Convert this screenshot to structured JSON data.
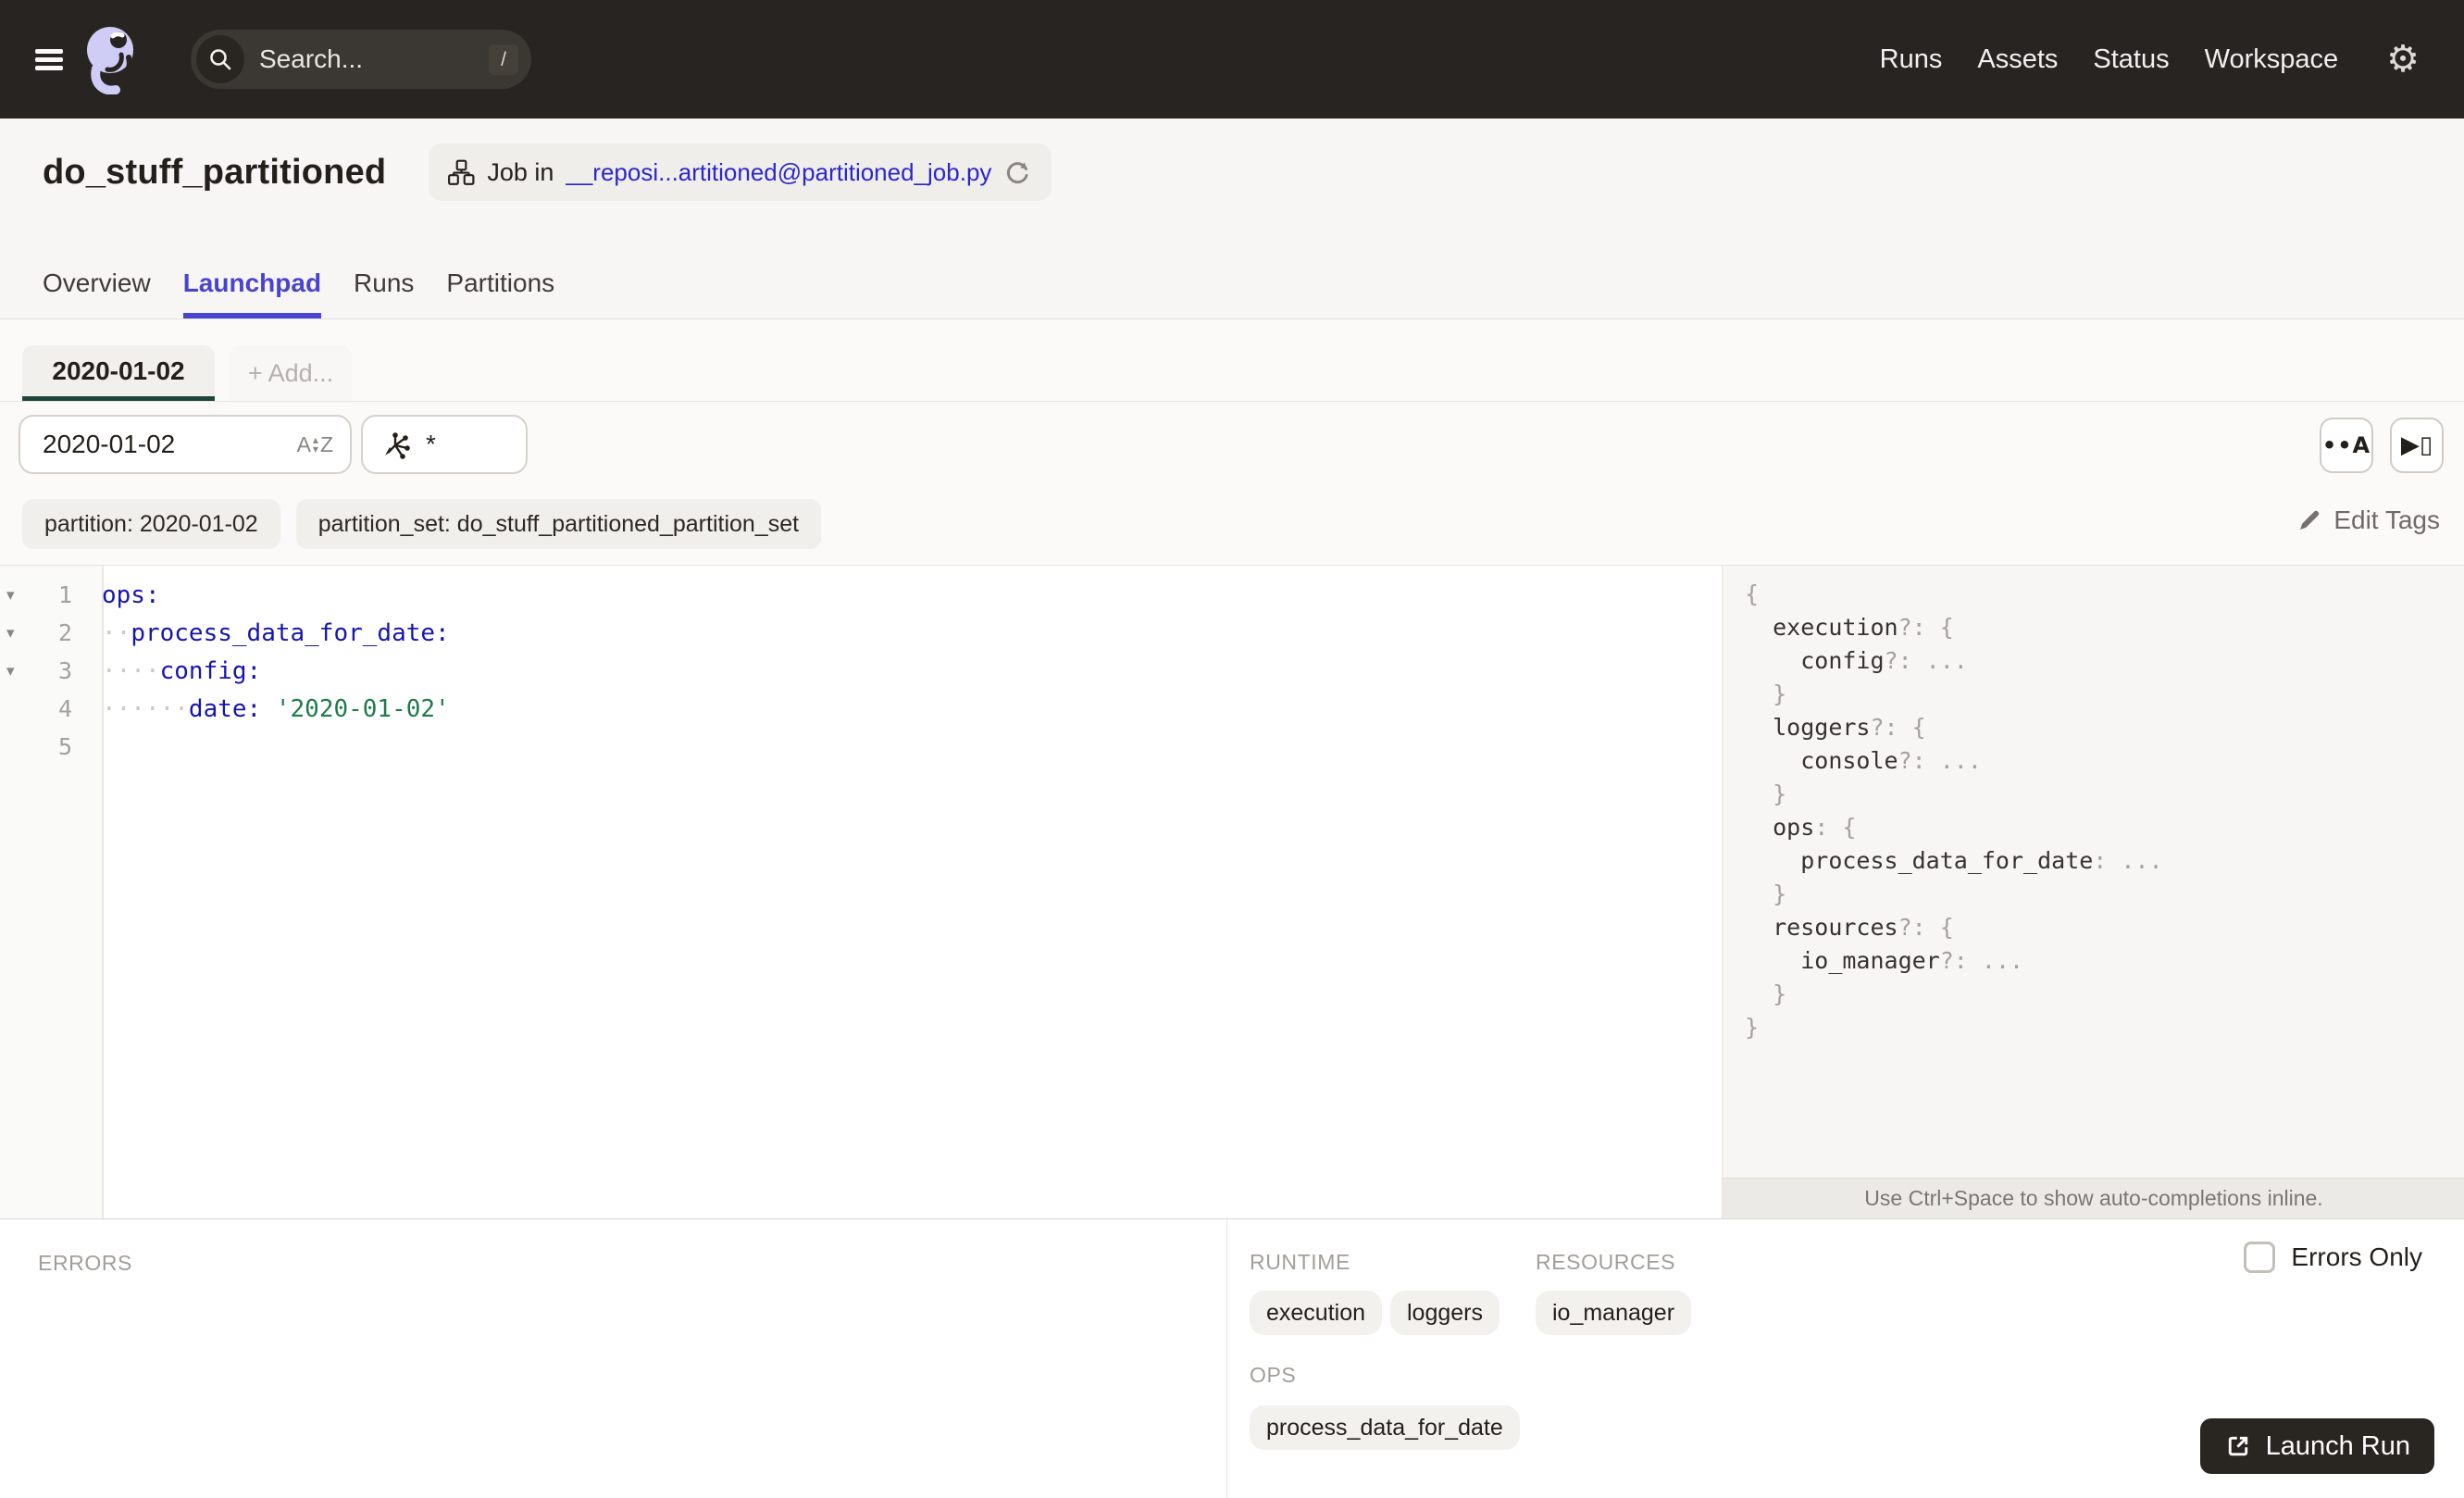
{
  "colors": {
    "topbar_bg": "#282421",
    "accent_blue": "#4a43d2",
    "link_blue": "#2d26c9",
    "partition_underline_green": "#21453a",
    "code_key": "#1715ad",
    "code_string": "#1e7b4a",
    "chip_bg": "#f3f1ee",
    "launch_button_bg": "#292521"
  },
  "topbar": {
    "search_placeholder": "Search...",
    "search_shortcut": "/",
    "nav": [
      "Runs",
      "Assets",
      "Status",
      "Workspace"
    ]
  },
  "header": {
    "title": "do_stuff_partitioned",
    "job_prefix": "Job in",
    "job_link": "__reposi...artitioned@partitioned_job.py"
  },
  "tabs": [
    "Overview",
    "Launchpad",
    "Runs",
    "Partitions"
  ],
  "partition_tabs": {
    "active": "2020-01-02",
    "add": "+ Add..."
  },
  "controls": {
    "partition_value": "2020-01-02",
    "op_query": "*",
    "autocomplete_button": "••A",
    "apply_button": "▶▯"
  },
  "tags": [
    "partition: 2020-01-02",
    "partition_set: do_stuff_partitioned_partition_set"
  ],
  "edit_tags": "Edit Tags",
  "editor": {
    "fold_glyph": "▾",
    "lines": [
      {
        "n": "1",
        "fold": "▾",
        "dots": "",
        "key": "ops:",
        "val": ""
      },
      {
        "n": "2",
        "fold": "▾",
        "dots": "··",
        "key": "process_data_for_date:",
        "val": ""
      },
      {
        "n": "3",
        "fold": "▾",
        "dots": "····",
        "key": "config:",
        "val": ""
      },
      {
        "n": "4",
        "fold": "",
        "dots": "······",
        "key": "date:",
        "val": " '2020-01-02'"
      },
      {
        "n": "5",
        "fold": "",
        "dots": "",
        "key": "",
        "val": ""
      }
    ]
  },
  "schema": {
    "lines": [
      {
        "pre": "",
        "name": "",
        "punct": "{"
      },
      {
        "pre": "  ",
        "name": "execution",
        "punct": "?: {"
      },
      {
        "pre": "    ",
        "name": "config",
        "punct": "?: ..."
      },
      {
        "pre": "  ",
        "name": "",
        "punct": "}"
      },
      {
        "pre": "  ",
        "name": "loggers",
        "punct": "?: {"
      },
      {
        "pre": "    ",
        "name": "console",
        "punct": "?: ..."
      },
      {
        "pre": "  ",
        "name": "",
        "punct": "}"
      },
      {
        "pre": "  ",
        "name": "ops",
        "punct": ": {"
      },
      {
        "pre": "    ",
        "name": "process_data_for_date",
        "punct": ": ..."
      },
      {
        "pre": "  ",
        "name": "",
        "punct": "}"
      },
      {
        "pre": "  ",
        "name": "resources",
        "punct": "?: {"
      },
      {
        "pre": "    ",
        "name": "io_manager",
        "punct": "?: ..."
      },
      {
        "pre": "  ",
        "name": "",
        "punct": "}"
      },
      {
        "pre": "",
        "name": "",
        "punct": "}"
      }
    ],
    "hint": "Use Ctrl+Space to show auto-completions inline."
  },
  "bottom": {
    "errors_label": "ERRORS",
    "runtime_label": "RUNTIME",
    "runtime_chips": [
      "execution",
      "loggers"
    ],
    "resources_label": "RESOURCES",
    "resources_chips": [
      "io_manager"
    ],
    "ops_label": "OPS",
    "ops_chips": [
      "process_data_for_date"
    ],
    "errors_only_label": "Errors Only",
    "launch_label": "Launch Run"
  }
}
